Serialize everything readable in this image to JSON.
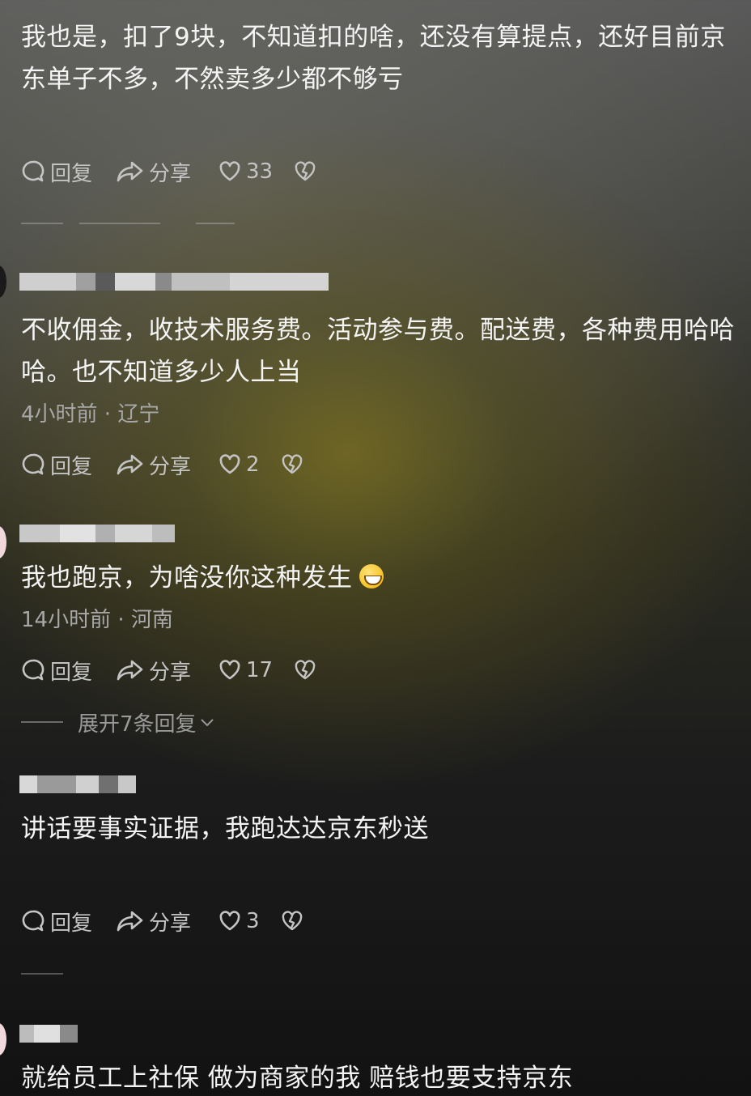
{
  "comments": [
    {
      "text": "我也是，扣了9块，不知道扣的啥，还没有算提点，还好目前京东单子不多，不然卖多少都不够亏",
      "meta": "",
      "reply_label": "回复",
      "share_label": "分享",
      "likes": "33"
    },
    {
      "text": "不收佣金，收技术服务费。活动参与费。配送费，各种费用哈哈哈。也不知道多少人上当",
      "meta": "4小时前 · 辽宁",
      "reply_label": "回复",
      "share_label": "分享",
      "likes": "2"
    },
    {
      "text": "我也跑京，为啥没你这种发生",
      "meta": "14小时前 · 河南",
      "reply_label": "回复",
      "share_label": "分享",
      "likes": "17",
      "expand_label": "展开7条回复"
    },
    {
      "text": "讲话要事实证据，我跑达达京东秒送",
      "meta": "",
      "reply_label": "回复",
      "share_label": "分享",
      "likes": "3"
    },
    {
      "text": "就给员工上社保  做为商家的我  赔钱也要支持京东"
    }
  ],
  "icons": {
    "reply": "comment-bubble-icon",
    "share": "share-arrow-icon",
    "like": "heart-icon",
    "dislike": "broken-heart-icon",
    "emoji": "grinning-face-emoji",
    "expand": "chevron-down-icon"
  },
  "colors": {
    "text": "#f4f4f4",
    "meta": "#a8a8a8",
    "action": "#c4c4c4"
  }
}
